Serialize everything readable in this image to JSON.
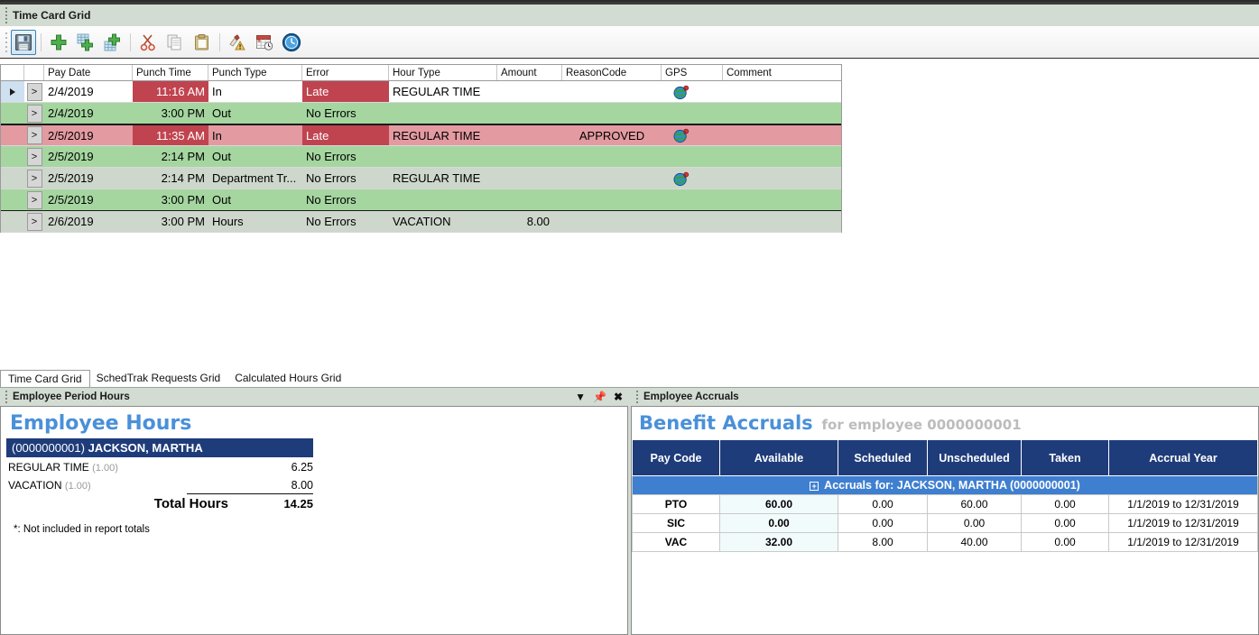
{
  "window": {
    "caption": "Time Card Grid"
  },
  "toolbar": {
    "buttons": [
      {
        "name": "save-button",
        "icon": "save-floppy-icon",
        "label": "Save",
        "selected": true
      },
      {
        "name": "add-row-button",
        "icon": "plus-green-icon",
        "label": "Add Row",
        "selected": false
      },
      {
        "name": "insert-row-button",
        "icon": "insert-plus-icon",
        "label": "Insert Row",
        "selected": false
      },
      {
        "name": "append-row-button",
        "icon": "append-plus-icon",
        "label": "Append Row",
        "selected": false
      },
      {
        "name": "cut-button",
        "icon": "scissors-icon",
        "label": "Cut",
        "selected": false
      },
      {
        "name": "copy-button",
        "icon": "copy-pages-icon",
        "label": "Copy",
        "selected": false
      },
      {
        "name": "paste-button",
        "icon": "clipboard-icon",
        "label": "Paste",
        "selected": false
      },
      {
        "name": "fix-errors-button",
        "icon": "broom-warning-icon",
        "label": "Fix Errors",
        "selected": false
      },
      {
        "name": "calendar-button",
        "icon": "calendar-clock-icon",
        "label": "Calendar",
        "selected": false
      },
      {
        "name": "time-button",
        "icon": "clock-icon",
        "label": "Time",
        "selected": false
      }
    ]
  },
  "grid": {
    "columns": [
      "",
      "",
      "Pay Date",
      "Punch Time",
      "Punch Type",
      "Error",
      "Hour Type",
      "Amount",
      "ReasonCode",
      "GPS",
      "Comment"
    ],
    "rows": [
      {
        "selected": true,
        "style": "white",
        "expander": ">",
        "pay_date": "2/4/2019",
        "punch_time": "11:16 AM",
        "time_flag": true,
        "punch_type": "In",
        "error": "Late",
        "error_flag": true,
        "hour_type": "REGULAR TIME",
        "amount": "",
        "reason_code": "",
        "gps": "gps-globe-icon",
        "comment": ""
      },
      {
        "selected": false,
        "style": "green",
        "expander": ">",
        "pay_date": "2/4/2019",
        "punch_time": "3:00 PM",
        "time_flag": false,
        "punch_type": "Out",
        "error": "No Errors",
        "error_flag": false,
        "hour_type": "",
        "amount": "",
        "reason_code": "",
        "gps": "",
        "comment": ""
      },
      {
        "selected": false,
        "style": "pink",
        "expander": ">",
        "pay_date": "2/5/2019",
        "punch_time": "11:35 AM",
        "time_flag": true,
        "punch_type": "In",
        "error": "Late",
        "error_flag": true,
        "hour_type": "REGULAR TIME",
        "amount": "",
        "reason_code": "APPROVED",
        "gps": "gps-globe-icon",
        "comment": ""
      },
      {
        "selected": false,
        "style": "green",
        "expander": ">",
        "pay_date": "2/5/2019",
        "punch_time": "2:14 PM",
        "time_flag": false,
        "punch_type": "Out",
        "error": "No Errors",
        "error_flag": false,
        "hour_type": "",
        "amount": "",
        "reason_code": "",
        "gps": "",
        "comment": ""
      },
      {
        "selected": false,
        "style": "greenlt",
        "expander": ">",
        "pay_date": "2/5/2019",
        "punch_time": "2:14 PM",
        "time_flag": false,
        "punch_type": "Department Tr...",
        "error": "No Errors",
        "error_flag": false,
        "hour_type": "REGULAR TIME",
        "amount": "",
        "reason_code": "",
        "gps": "gps-globe-icon",
        "comment": ""
      },
      {
        "selected": false,
        "style": "green",
        "expander": ">",
        "pay_date": "2/5/2019",
        "punch_time": "3:00 PM",
        "time_flag": false,
        "punch_type": "Out",
        "error": "No Errors",
        "error_flag": false,
        "hour_type": "",
        "amount": "",
        "reason_code": "",
        "gps": "",
        "comment": ""
      },
      {
        "selected": false,
        "style": "greenlt",
        "expander": ">",
        "pay_date": "2/6/2019",
        "punch_time": "3:00 PM",
        "time_flag": false,
        "punch_type": "Hours",
        "error": "No Errors",
        "error_flag": false,
        "hour_type": "VACATION",
        "amount": "8.00",
        "reason_code": "",
        "gps": "",
        "comment": ""
      }
    ]
  },
  "tabs": [
    {
      "label": "Time Card Grid",
      "active": true
    },
    {
      "label": "SchedTrak Requests Grid",
      "active": false
    },
    {
      "label": "Calculated Hours Grid",
      "active": false
    }
  ],
  "employee_hours_panel": {
    "panel_title": "Employee Period Hours",
    "actions": [
      "dropdown-caret-icon",
      "pin-icon",
      "close-icon"
    ],
    "heading": "Employee Hours",
    "employee_id": "(0000000001)",
    "employee_name": "JACKSON, MARTHA",
    "lines": [
      {
        "label": "REGULAR TIME",
        "multiplier": "(1.00)",
        "value": "6.25"
      },
      {
        "label": "VACATION",
        "multiplier": "(1.00)",
        "value": "8.00"
      }
    ],
    "total_label": "Total Hours",
    "total_value": "14.25",
    "footnote": "*: Not included in report totals"
  },
  "accruals_panel": {
    "panel_title": "Employee Accruals",
    "heading": "Benefit Accruals",
    "heading_suffix": "for employee 0000000001",
    "columns": [
      "Pay Code",
      "Available",
      "Scheduled",
      "Unscheduled",
      "Taken",
      "Accrual Year"
    ],
    "group_row": "Accruals for: JACKSON, MARTHA (0000000001)",
    "group_expander": "+",
    "rows": [
      {
        "pay_code": "PTO",
        "available": "60.00",
        "scheduled": "0.00",
        "unscheduled": "60.00",
        "taken": "0.00",
        "accrual_year": "1/1/2019 to 12/31/2019"
      },
      {
        "pay_code": "SIC",
        "available": "0.00",
        "scheduled": "0.00",
        "unscheduled": "0.00",
        "taken": "0.00",
        "accrual_year": "1/1/2019 to 12/31/2019"
      },
      {
        "pay_code": "VAC",
        "available": "32.00",
        "scheduled": "8.00",
        "unscheduled": "40.00",
        "taken": "0.00",
        "accrual_year": "1/1/2019 to 12/31/2019"
      }
    ]
  },
  "colors": {
    "caption_bg": "#d3dcd2",
    "accent_blue": "#4a90d9",
    "header_navy": "#1f3c7a",
    "group_blue": "#3f7fd0",
    "row_green": "#a5d6a0",
    "row_pink": "#e39aa1",
    "error_red": "#c0444f"
  }
}
